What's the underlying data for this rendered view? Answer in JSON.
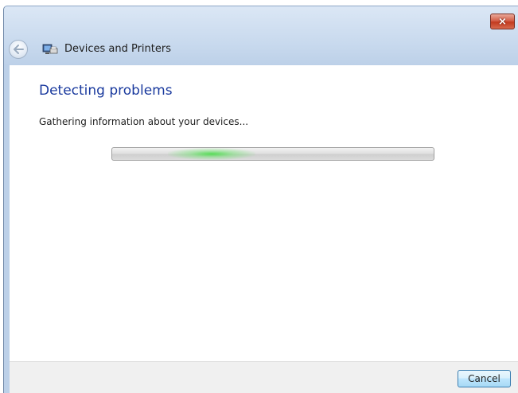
{
  "window": {
    "title": "Devices and Printers",
    "close_label": "×"
  },
  "icons": {
    "back": "back-arrow-icon",
    "app": "devices-printers-icon",
    "close": "close-icon"
  },
  "content": {
    "heading": "Detecting problems",
    "status": "Gathering information about your devices..."
  },
  "footer": {
    "cancel_label": "Cancel"
  },
  "colors": {
    "heading": "#1a3a9e",
    "progress_glow": "#3ad43a",
    "close_red": "#c23a1e"
  }
}
